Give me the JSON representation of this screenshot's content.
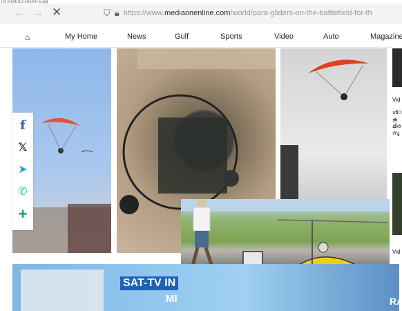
{
  "caption": "[2] 2024013-1650-0-5.jpg",
  "browser": {
    "url_prefix": "https://www.",
    "url_domain": "mediaonenline.com",
    "url_path": "/world/para-gliders-on-the-battlefield-for-th"
  },
  "nav": {
    "items": [
      "My Home",
      "News",
      "Gulf",
      "Sports",
      "Video",
      "Auto",
      "Magazine"
    ]
  },
  "right_column": {
    "label1": "Vid",
    "lines": [
      "ൾറ",
      "കൂ",
      "മിര",
      "സു"
    ],
    "label2": "Vid"
  },
  "banner": {
    "sattv": "SAT-TV",
    "sattv_suffix": "IN",
    "line2": "MI",
    "right_text": "RA"
  },
  "colors": {
    "facebook": "#3b5998",
    "x": "#111111",
    "telegram": "#229ed9",
    "whatsapp": "#25d366",
    "plus": "#16a34a",
    "glider": "#e8532e"
  }
}
